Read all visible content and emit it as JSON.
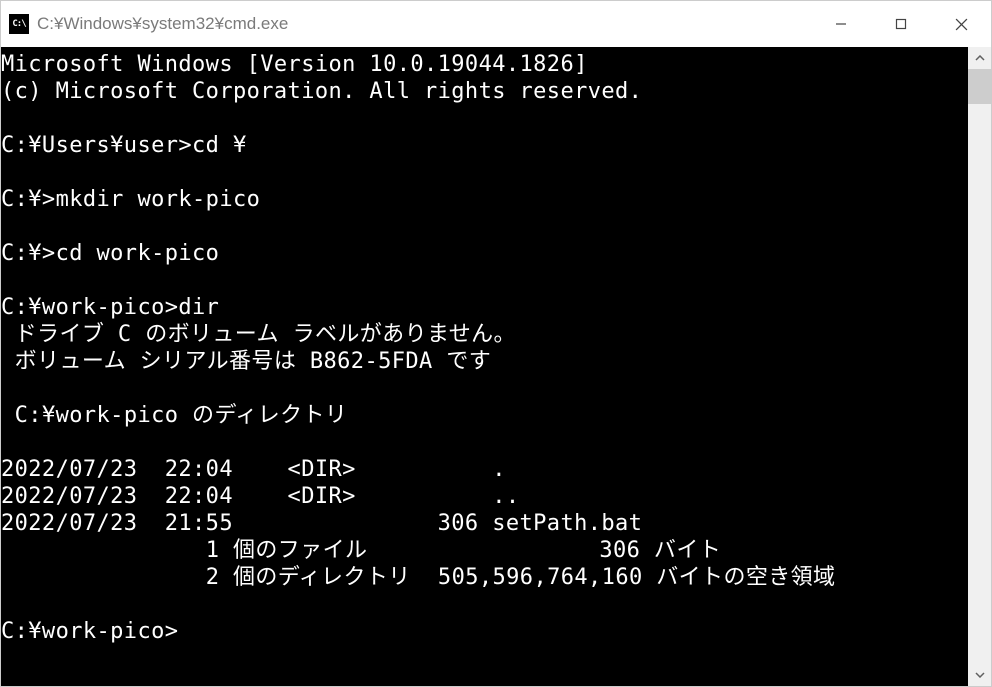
{
  "window": {
    "icon_text": "C:\\",
    "title": "C:¥Windows¥system32¥cmd.exe"
  },
  "terminal": {
    "lines": [
      "Microsoft Windows [Version 10.0.19044.1826]",
      "(c) Microsoft Corporation. All rights reserved.",
      "",
      "C:¥Users¥user>cd ¥",
      "",
      "C:¥>mkdir work-pico",
      "",
      "C:¥>cd work-pico",
      "",
      "C:¥work-pico>dir",
      " ドライブ C のボリューム ラベルがありません。",
      " ボリューム シリアル番号は B862-5FDA です",
      "",
      " C:¥work-pico のディレクトリ",
      "",
      "2022/07/23  22:04    <DIR>          .",
      "2022/07/23  22:04    <DIR>          ..",
      "2022/07/23  21:55               306 setPath.bat",
      "               1 個のファイル                 306 バイト",
      "               2 個のディレクトリ  505,596,764,160 バイトの空き領域",
      "",
      "C:¥work-pico>"
    ]
  }
}
